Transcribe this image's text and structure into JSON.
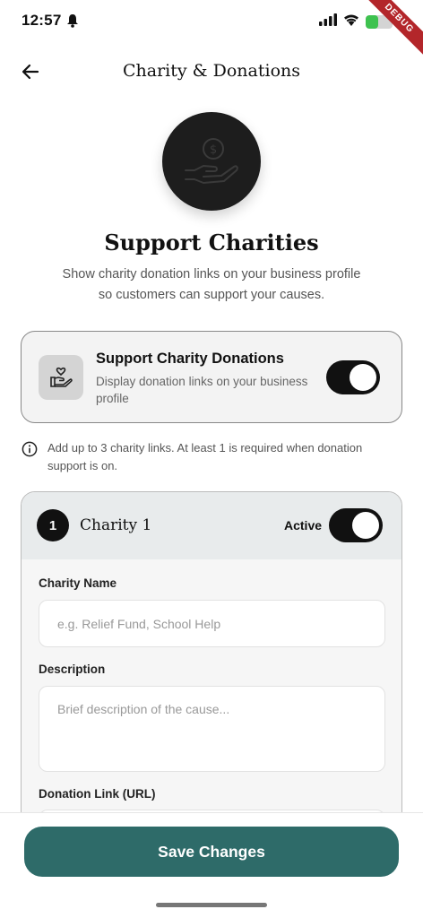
{
  "status_bar": {
    "time": "12:57",
    "battery_level": 0.45,
    "debug_banner": "DEBUG"
  },
  "app_bar": {
    "title": "Charity & Donations",
    "back_icon": "arrow-left-icon"
  },
  "hero": {
    "icon": "hand-coin-icon",
    "title": "Support Charities",
    "subtitle": "Show charity donation links on your business profile so customers can support your causes."
  },
  "support_card": {
    "icon": "hand-heart-icon",
    "title": "Support Charity Donations",
    "description": "Display donation links on your business profile",
    "enabled": true
  },
  "info_note": {
    "icon": "info-icon",
    "text": "Add up to 3 charity links. At least 1 is required when donation support is on."
  },
  "charity": {
    "number": "1",
    "title": "Charity 1",
    "active_label": "Active",
    "active": true,
    "fields": {
      "name_label": "Charity Name",
      "name_value": "",
      "name_placeholder": "e.g. Relief Fund, School Help",
      "description_label": "Description",
      "description_value": "",
      "description_placeholder": "Brief description of the cause...",
      "link_label": "Donation Link (URL)",
      "link_value": ""
    }
  },
  "footer": {
    "save_label": "Save Changes"
  },
  "colors": {
    "primary": "#2e6b69",
    "toggle_on": "#111111",
    "battery": "#3ec24f"
  }
}
